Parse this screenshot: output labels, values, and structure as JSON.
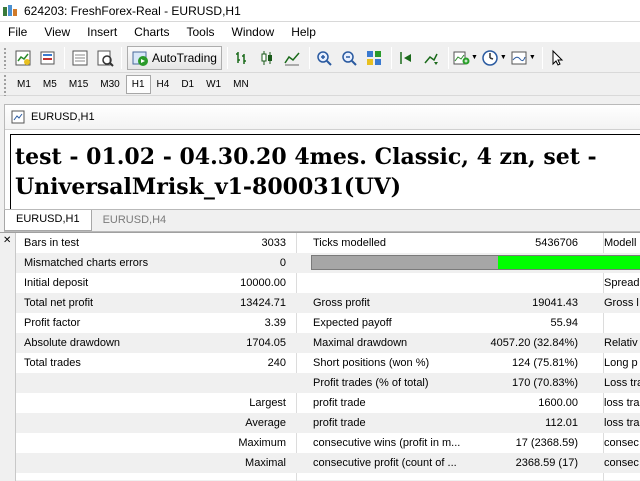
{
  "window": {
    "title": "624203: FreshForex-Real - EURUSD,H1"
  },
  "menu": [
    "File",
    "View",
    "Insert",
    "Charts",
    "Tools",
    "Window",
    "Help"
  ],
  "toolbar": {
    "autotrading_label": "AutoTrading",
    "icons": [
      "new-chart-icon",
      "profiles-icon",
      "market-watch-icon",
      "navigator-icon",
      "autotrading-icon",
      "bar-chart-icon",
      "candlestick-icon",
      "line-chart-icon",
      "zoom-in-icon",
      "zoom-out-icon",
      "tile-windows-icon",
      "chart-shift-icon",
      "autoscroll-icon",
      "indicators-icon",
      "periods-icon",
      "templates-icon",
      "cursor-icon"
    ]
  },
  "timeframes": {
    "items": [
      "M1",
      "M5",
      "M15",
      "M30",
      "H1",
      "H4",
      "D1",
      "W1",
      "MN"
    ],
    "active": "H1"
  },
  "chart_window": {
    "title": "EURUSD,H1",
    "report_title": "test - 01.02 - 04.30.20 4mes. Classic, 4 zn, set - UniversalMrisk_v1-800031(UV)"
  },
  "chart_tabs": {
    "items": [
      "EURUSD,H1",
      "EURUSD,H4"
    ],
    "active": "EURUSD,H1"
  },
  "report": {
    "rows": [
      {
        "c1": "Bars in test",
        "c2": "3033",
        "c3": "Ticks modelled",
        "c4": "5436706",
        "c5": "Modell"
      },
      {
        "c1": "Mismatched charts errors",
        "c2": "0",
        "quality_bar": {
          "gray_fraction": 0.55,
          "green_fraction": 0.45
        }
      },
      {
        "c1": "Initial deposit",
        "c2": "10000.00",
        "c3": "",
        "c4": "",
        "c5": "Spread"
      },
      {
        "c1": "Total net profit",
        "c2": "13424.71",
        "c3": "Gross profit",
        "c4": "19041.43",
        "c5": "Gross l"
      },
      {
        "c1": "Profit factor",
        "c2": "3.39",
        "c3": "Expected payoff",
        "c4": "55.94",
        "c5": ""
      },
      {
        "c1": "Absolute drawdown",
        "c2": "1704.05",
        "c3": "Maximal drawdown",
        "c4": "4057.20 (32.84%)",
        "c5": "Relativ"
      },
      {
        "c1": "Total trades",
        "c2": "240",
        "c3": "Short positions (won %)",
        "c4": "124 (75.81%)",
        "c5": "Long p"
      },
      {
        "c1": "",
        "c2": "",
        "c3": "Profit trades (% of total)",
        "c4": "170 (70.83%)",
        "c5": "Loss tra"
      },
      {
        "c1r": "Largest",
        "c3": "profit trade",
        "c4": "1600.00",
        "c5": "loss tra"
      },
      {
        "c1r": "Average",
        "c3": "profit trade",
        "c4": "112.01",
        "c5": "loss tra"
      },
      {
        "c1r": "Maximum",
        "c3": "consecutive wins (profit in m...",
        "c4": "17 (2368.59)",
        "c5": "consec"
      },
      {
        "c1r": "Maximal",
        "c3": "consecutive profit (count of ...",
        "c4": "2368.59 (17)",
        "c5": "consec"
      }
    ]
  }
}
